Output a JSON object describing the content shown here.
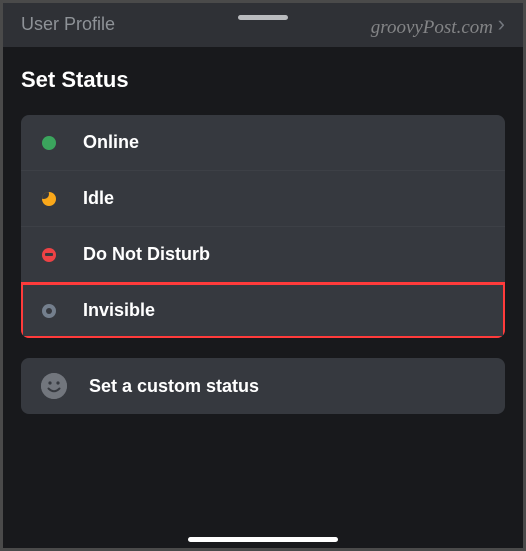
{
  "top": {
    "title": "User Profile"
  },
  "sheet": {
    "title": "Set Status"
  },
  "statuses": [
    {
      "key": "online",
      "label": "Online"
    },
    {
      "key": "idle",
      "label": "Idle"
    },
    {
      "key": "dnd",
      "label": "Do Not Disturb"
    },
    {
      "key": "invisible",
      "label": "Invisible"
    }
  ],
  "highlighted_status": "invisible",
  "custom": {
    "label": "Set a custom status"
  },
  "watermark": "groovyPost.com"
}
